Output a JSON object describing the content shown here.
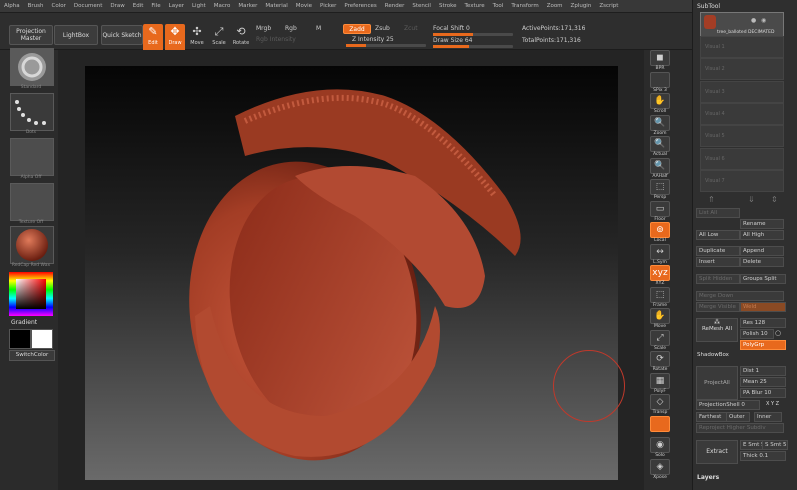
{
  "menu": [
    "Alpha",
    "Brush",
    "Color",
    "Document",
    "Draw",
    "Edit",
    "File",
    "Layer",
    "Light",
    "Macro",
    "Marker",
    "Material",
    "Movie",
    "Picker",
    "Preferences",
    "Render",
    "Stencil",
    "Stroke",
    "Texture",
    "Tool",
    "Transform",
    "Zoom",
    "Zplugin",
    "Zscript"
  ],
  "toolbar": {
    "projection_master": "Projection Master",
    "lightbox": "LightBox",
    "quick_sketch": "Quick Sketch",
    "edit": "Edit",
    "draw": "Draw",
    "move": "Move",
    "scale": "Scale",
    "rotate": "Rotate",
    "mrgb": "Mrgb",
    "rgb": "Rgb",
    "m": "M",
    "rgb_intensity": "Rgb Intensity",
    "zadd": "Zadd",
    "zsub": "Zsub",
    "zcut": "Zcut",
    "z_intensity_label": "Z Intensity",
    "z_intensity_value": "25",
    "focal_shift_label": "Focal Shift",
    "focal_shift_value": "0",
    "draw_size_label": "Draw Size",
    "draw_size_value": "64",
    "active_points_label": "ActivePoints:",
    "active_points_value": "171,316",
    "total_points_label": "TotalPoints:",
    "total_points_value": "171,316",
    "z_intensity_level": 0.25,
    "focal_shift_level": 0.5,
    "draw_size_level": 0.45
  },
  "left_shelf": {
    "brush_label": "Standard",
    "stroke_label": "Dots",
    "alpha_label": "Alpha Off",
    "texture_label": "Texture Off",
    "material_label": "RedCap Red Wax",
    "gradient_label": "Gradient",
    "switch_color_label": "SwitchColor"
  },
  "right_shelf": [
    {
      "id": "bpr",
      "label": "BPR"
    },
    {
      "id": "spix",
      "label": "SPix 3"
    },
    {
      "id": "scroll",
      "label": "Scroll"
    },
    {
      "id": "zoom",
      "label": "Zoom"
    },
    {
      "id": "actual",
      "label": "Actual"
    },
    {
      "id": "aahalf",
      "label": "AAHalf"
    },
    {
      "id": "persp",
      "label": "Persp"
    },
    {
      "id": "floor",
      "label": "Floor"
    },
    {
      "id": "local",
      "label": "Local"
    },
    {
      "id": "lsym",
      "label": "L.Sym"
    },
    {
      "id": "xyz",
      "label": "XYZ"
    },
    {
      "id": "frame",
      "label": "Frame"
    },
    {
      "id": "move",
      "label": "Move"
    },
    {
      "id": "scale",
      "label": "Scale"
    },
    {
      "id": "rotate",
      "label": "Rotate"
    },
    {
      "id": "polyf",
      "label": "PolyF"
    },
    {
      "id": "transp",
      "label": "Transp"
    },
    {
      "id": "ghost",
      "label": ""
    },
    {
      "id": "solo",
      "label": "Solo"
    },
    {
      "id": "xpose",
      "label": "Xpose"
    }
  ],
  "subtool": {
    "header": "SubTool",
    "active_name": "tree_balloted DECIMATED",
    "slots": [
      "Visual 1",
      "Visual 2",
      "Visual 3",
      "Visual 4",
      "Visual 5",
      "Visual 6",
      "Visual 7"
    ],
    "list_all": "List All",
    "rename": "Rename",
    "all_low": "All Low",
    "all_high": "All High",
    "duplicate": "Duplicate",
    "append": "Append",
    "insert": "Insert",
    "delete": "Delete",
    "split_hidden": "Split Hidden",
    "groups_split": "Groups Split",
    "merge_down": "Merge Down",
    "merge_visible": "Merge Visible",
    "weld": "Weld",
    "remesh_all": "ReMesh All",
    "res_label": "Res",
    "res_value": "128",
    "polish_label": "Polish",
    "polish_value": "10",
    "polygrp": "PolyGrp",
    "shadowbox": "ShadowBox",
    "project_all": "ProjectAll",
    "dist_label": "Dist",
    "dist_value": "1",
    "mean_label": "Mean",
    "mean_value": "25",
    "pa_blur_label": "PA Blur",
    "pa_blur_value": "10",
    "projection_shell_label": "ProjectionShell",
    "projection_shell_value": "0",
    "xyz": "X Y Z",
    "farthest": "Farthest",
    "outer": "Outer",
    "inner": "Inner",
    "reproject": "Reproject Higher Subdiv",
    "extract": "Extract",
    "e_smt": "E Smt",
    "e_smt_value": "5",
    "s_smt": "S Smt",
    "s_smt_value": "5",
    "thick_label": "Thick",
    "thick_value": "0.1",
    "layers": "Layers"
  },
  "colors": {
    "accent": "#e8691d",
    "wax": "#a33d25",
    "panel": "#2f2f2f",
    "bg": "#2b2b2b"
  }
}
